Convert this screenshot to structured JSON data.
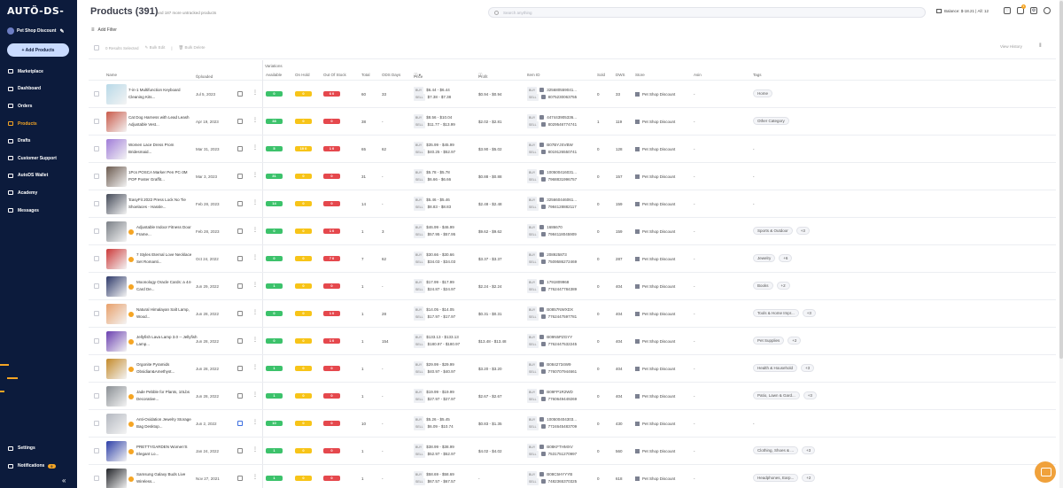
{
  "sidebar": {
    "logo": "AUTÖ-DS-",
    "store": "Pet Shop Discount",
    "add_products": "+ Add Products",
    "items": [
      {
        "label": "Marketplace",
        "icon": "marketplace-icon"
      },
      {
        "label": "Dashboard",
        "icon": "dashboard-icon"
      },
      {
        "label": "Orders",
        "icon": "orders-icon"
      },
      {
        "label": "Products",
        "icon": "products-icon"
      },
      {
        "label": "Drafts",
        "icon": "drafts-icon"
      },
      {
        "label": "Customer Support",
        "icon": "support-icon"
      },
      {
        "label": "AutoDS Wallet",
        "icon": "wallet-icon"
      },
      {
        "label": "Academy",
        "icon": "academy-icon"
      },
      {
        "label": "Messages",
        "icon": "messages-icon"
      }
    ],
    "settings": "Settings",
    "notifications": "Notifications",
    "notifications_count": "9",
    "collapse": "«",
    "accent": "#f5a524",
    "bg": "#0c1b3c"
  },
  "header": {
    "title": "Products (391)",
    "subtitle": "and 187 more untracked products",
    "search_placeholder": "Search anything",
    "balance": "Balance: $-18.21 | All: 12",
    "notif_count": "3"
  },
  "filter": {
    "add_filter": "Add Filter"
  },
  "toolbar": {
    "selected": "0 Results Selected",
    "bulk_edit": "Bulk Edit",
    "bulk_delete": "Bulk Delete",
    "view_history": "View History"
  },
  "columns": {
    "variations": "Variations",
    "name": "Name",
    "uploaded": "Uploaded",
    "available": "Available",
    "on_hold": "On Hold",
    "out_of_stock": "Out Of Stock",
    "total": "Total",
    "ods_days": "ODS Days",
    "price": "Price",
    "profit": "Profit",
    "item_id": "Item ID",
    "sold": "Sold",
    "dws": "DWS",
    "store": "Store",
    "asin": "Asin",
    "tags": "Tags"
  },
  "labels": {
    "buy": "BUY",
    "sell": "SELL"
  },
  "rows": [
    {
      "title": "7-in-1 Multifunction Keyboard Cleaning Kits...",
      "uploaded": "Jul 5, 2023",
      "available": "0",
      "on_hold": "0",
      "out_of_stock": "6 0",
      "total": "60",
      "ods": "33",
      "buy": "$6.44 - $6.44",
      "sell": "$7.38 - $7.38",
      "profit": "$0.94 - $0.94",
      "id1": "325680559041...",
      "id2": "8075230063755",
      "sold": "0",
      "dws": "33",
      "store": "Pet Shop Discount",
      "asin": "-",
      "tags": [
        "Home"
      ],
      "warn": false,
      "note_blue": false,
      "color": "#b8d9e8"
    },
    {
      "title": "Cat Dog Harness with Lead Leash Adjustable Vest...",
      "uploaded": "Apr 19, 2023",
      "available": "38",
      "on_hold": "0",
      "out_of_stock": "0",
      "total": "38",
      "ods": "-",
      "buy": "$8.56 - $10.04",
      "sell": "$11.77 - $13.99",
      "profit": "$2.02 - $2.81",
      "id1": "447443905336...",
      "id2": "8029546774741",
      "sold": "1",
      "dws": "119",
      "store": "Pet Shop Discount",
      "asin": "-",
      "tags": [
        "Other Category"
      ],
      "warn": false,
      "note_blue": false,
      "color": "#c95a4a"
    },
    {
      "title": "Women Lace Dress Prom Bridesmaid...",
      "uploaded": "Mar 31, 2023",
      "available": "5",
      "on_hold": "10 0",
      "out_of_stock": "1 0",
      "total": "65",
      "ods": "62",
      "buy": "$35.99 - $45.99",
      "sell": "$40.25 - $52.97",
      "profit": "$3.90 - $5.02",
      "id1": "B07BYJSVBW",
      "id2": "8019126550741",
      "sold": "0",
      "dws": "128",
      "store": "Pet Shop Discount",
      "asin": "-",
      "tags": [],
      "warn": false,
      "note_blue": false,
      "color": "#a07cd8"
    },
    {
      "title": "1Pcs POSCA Marker Pen PC-3M POP Poster Graffit...",
      "uploaded": "Mar 3, 2023",
      "available": "31",
      "on_hold": "0",
      "out_of_stock": "0",
      "total": "31",
      "ods": "-",
      "buy": "$5.78 - $5.78",
      "sell": "$6.66 - $6.66",
      "profit": "$0.88 - $0.88",
      "id1": "100500416031...",
      "id2": "7968831996757",
      "sold": "0",
      "dws": "157",
      "store": "Pet Shop Discount",
      "asin": "-",
      "tags": [],
      "warn": false,
      "note_blue": false,
      "color": "#6b5a4f"
    },
    {
      "title": "'EasyFit 2022 Press Lock No Tie Shoelaces - Hassle...",
      "uploaded": "Feb 28, 2023",
      "available": "14",
      "on_hold": "0",
      "out_of_stock": "0",
      "total": "14",
      "ods": "-",
      "buy": "$5.46 - $5.46",
      "sell": "$8.83 - $8.83",
      "profit": "$2.48 - $2.48",
      "id1": "325660446061...",
      "id2": "7984128882117",
      "sold": "0",
      "dws": "159",
      "store": "Pet Shop Discount",
      "asin": "-",
      "tags": [],
      "warn": false,
      "note_blue": false,
      "color": "#444a58"
    },
    {
      "title": "Adjustable Indoor Fitness Door Frame...",
      "uploaded": "Feb 28, 2023",
      "available": "0",
      "on_hold": "0",
      "out_of_stock": "1 0",
      "total": "1",
      "ods": "3",
      "buy": "$46.99 - $46.99",
      "sell": "$57.95 - $57.95",
      "profit": "$9.62 - $9.62",
      "id1": "1686670",
      "id2": "7984118045909",
      "sold": "0",
      "dws": "159",
      "store": "Pet Shop Discount",
      "asin": "-",
      "tags": [
        "Sports & Outdoor",
        "+3"
      ],
      "warn": true,
      "note_blue": false,
      "color": "#7a7f86"
    },
    {
      "title": "7 Styles Eternal Love Necklace Set Romanti...",
      "uploaded": "Oct 24, 2022",
      "available": "0",
      "on_hold": "0",
      "out_of_stock": "7 0",
      "total": "7",
      "ods": "62",
      "buy": "$30.66 - $30.66",
      "sell": "$34.03 - $34.03",
      "profit": "$3.37 - $3.37",
      "id1": "208925873",
      "id2": "7509586272469",
      "sold": "0",
      "dws": "287",
      "store": "Pet Shop Discount",
      "asin": "-",
      "tags": [
        "Jewelry",
        "+6"
      ],
      "warn": true,
      "note_blue": false,
      "color": "#cc3a3a"
    },
    {
      "title": "Moonology Oracle Cards: a 44-Card De...",
      "uploaded": "Jun 29, 2022",
      "available": "1",
      "on_hold": "0",
      "out_of_stock": "0",
      "total": "1",
      "ods": "-",
      "buy": "$17.99 - $17.99",
      "sell": "$24.87 - $24.97",
      "profit": "$2.24 - $2.24",
      "id1": "1791809968",
      "id2": "7762447784389",
      "sold": "0",
      "dws": "404",
      "store": "Pet Shop Discount",
      "asin": "-",
      "tags": [
        "Books",
        "+2"
      ],
      "warn": true,
      "note_blue": false,
      "color": "#2e3a6a"
    },
    {
      "title": "Natural Himalayan Salt Lamp, Wood...",
      "uploaded": "Jun 28, 2022",
      "available": "0",
      "on_hold": "0",
      "out_of_stock": "1 0",
      "total": "1",
      "ods": "28",
      "buy": "$14.05 - $14.05",
      "sell": "$17.97 - $17.97",
      "profit": "$0.31 - $0.31",
      "id1": "B0857NWXDX",
      "id2": "7762447597781",
      "sold": "0",
      "dws": "404",
      "store": "Pet Shop Discount",
      "asin": "-",
      "tags": [
        "Tools & Home Impr...",
        "+3"
      ],
      "warn": true,
      "note_blue": false,
      "color": "#e8a06a"
    },
    {
      "title": "Jellyfish Lava Lamp 3.0 -- Jellyfish Lamp...",
      "uploaded": "Jun 28, 2022",
      "available": "0",
      "on_hold": "0",
      "out_of_stock": "1 0",
      "total": "1",
      "ods": "154",
      "buy": "$133.13 - $133.13",
      "sell": "$180.97 - $180.97",
      "profit": "$13.48 - $13.48",
      "id1": "B09N5PZGYY",
      "id2": "7762447532245",
      "sold": "0",
      "dws": "404",
      "store": "Pet Shop Discount",
      "asin": "-",
      "tags": [
        "Pet Supplies",
        "+2"
      ],
      "warn": true,
      "note_blue": false,
      "color": "#6a3fb0"
    },
    {
      "title": "Orgonite Pyramids Obsidian&Amethyst...",
      "uploaded": "Jun 28, 2022",
      "available": "1",
      "on_hold": "0",
      "out_of_stock": "0",
      "total": "1",
      "ods": "-",
      "buy": "$29.99 - $29.99",
      "sell": "$40.97 - $40.97",
      "profit": "$3.20 - $3.20",
      "id1": "B0842734W9",
      "id2": "7760707944661",
      "sold": "0",
      "dws": "404",
      "store": "Pet Shop Discount",
      "asin": "-",
      "tags": [
        "Health & Household",
        "+3"
      ],
      "warn": true,
      "note_blue": false,
      "color": "#c48a2a"
    },
    {
      "title": "Jade Pebble for Plants, 10Lbs Decorative...",
      "uploaded": "Jun 28, 2022",
      "available": "1",
      "on_hold": "0",
      "out_of_stock": "0",
      "total": "1",
      "ods": "-",
      "buy": "$19.99 - $19.99",
      "sell": "$27.97 - $27.97",
      "profit": "$2.67 - $2.67",
      "id1": "B09FP1R2WD",
      "id2": "7760649449269",
      "sold": "0",
      "dws": "404",
      "store": "Pet Shop Discount",
      "asin": "-",
      "tags": [
        "Patio, Lawn & Gard...",
        "+3"
      ],
      "warn": true,
      "note_blue": false,
      "color": "#8a8f94"
    },
    {
      "title": "Anti-Oxidation Jewelry Storage Bag Desktop...",
      "uploaded": "Jun 2, 2022",
      "available": "10",
      "on_hold": "0",
      "out_of_stock": "0",
      "total": "10",
      "ods": "-",
      "buy": "$5.26 - $5.45",
      "sell": "$6.09 - $10.74",
      "profit": "$0.83 - $1.35",
      "id1": "100500404303...",
      "id2": "7724645483709",
      "sold": "0",
      "dws": "430",
      "store": "Pet Shop Discount",
      "asin": "-",
      "tags": [],
      "warn": true,
      "note_blue": true,
      "color": "#b4b8c0"
    },
    {
      "title": "PRETTYGARDEN Women'S Elegant Lo...",
      "uploaded": "Jan 24, 2022",
      "available": "1",
      "on_hold": "0",
      "out_of_stock": "0",
      "total": "1",
      "ods": "-",
      "buy": "$38.99 - $38.99",
      "sell": "$52.97 - $52.97",
      "profit": "$4.02 - $4.02",
      "id1": "B08KFTHMXV",
      "id2": "7531751270997",
      "sold": "0",
      "dws": "560",
      "store": "Pet Shop Discount",
      "asin": "-",
      "tags": [
        "Clothing, Shoes & ...",
        "+3"
      ],
      "warn": true,
      "note_blue": false,
      "color": "#2d3fa8"
    },
    {
      "title": "Samsung Galaxy Buds Live Wireless...",
      "uploaded": "Nov 27, 2021",
      "available": "1",
      "on_hold": "0",
      "out_of_stock": "0",
      "total": "1",
      "ods": "-",
      "buy": "$58.69 - $58.69",
      "sell": "$67.57 - $67.57",
      "profit": "-",
      "id1": "B08C5HYYYB",
      "id2": "7482365370325",
      "sold": "0",
      "dws": "618",
      "store": "Pet Shop Discount",
      "asin": "-",
      "tags": [
        "Headphones, Earp...",
        "+2"
      ],
      "warn": true,
      "note_blue": false,
      "color": "#222429"
    }
  ]
}
